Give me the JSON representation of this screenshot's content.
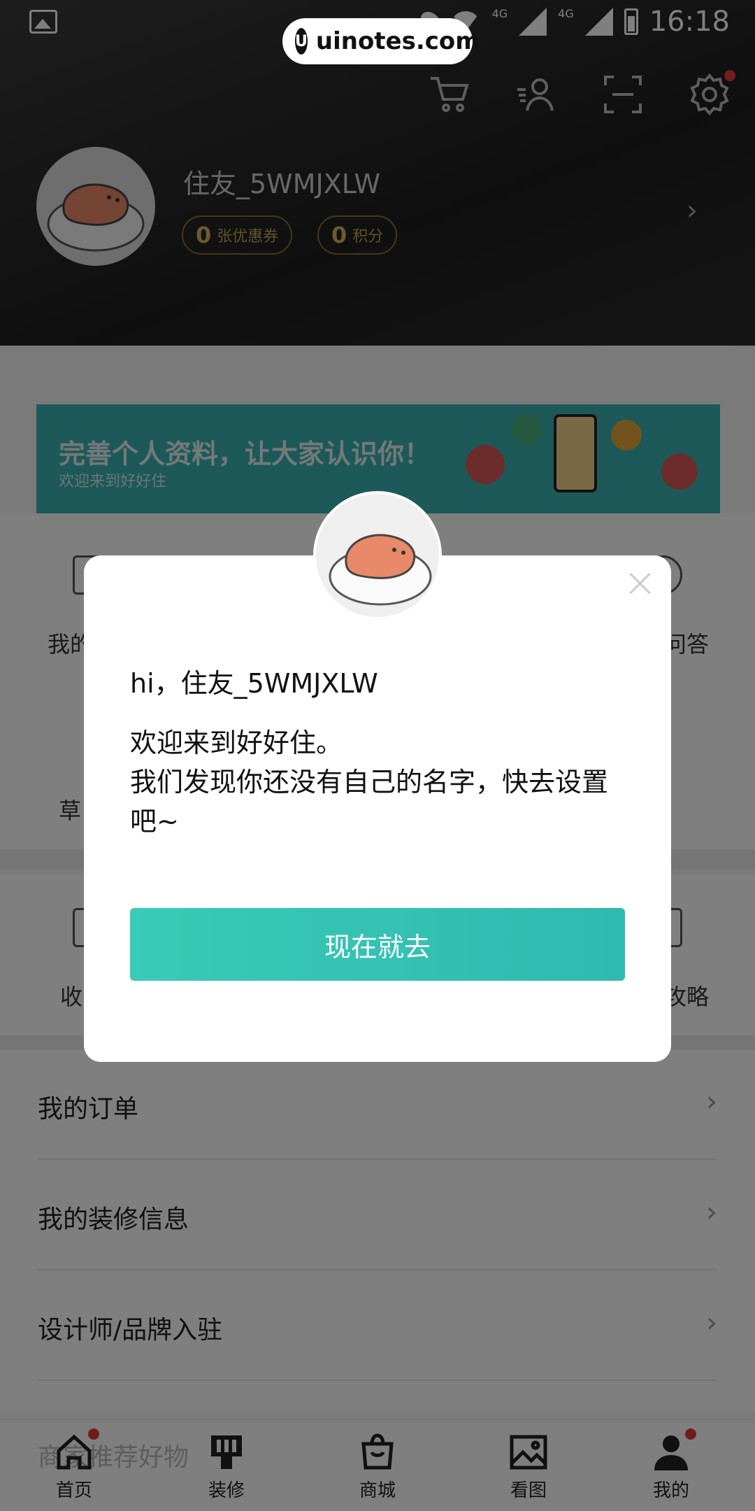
{
  "status_bar": {
    "network1": "4G",
    "network2": "4G",
    "time": "16:18"
  },
  "watermark": {
    "logo": "U",
    "text": "uinotes.com"
  },
  "header": {
    "icons": [
      "cart-icon",
      "user-list-icon",
      "scan-icon",
      "settings-icon"
    ],
    "username": "住友_5WMJXLW",
    "coupons": {
      "value": "0",
      "label": "张优惠券"
    },
    "points": {
      "value": "0",
      "label": "积分"
    },
    "chevron": "›"
  },
  "banner": {
    "title": "完善个人资料，让大家认识你！",
    "subtitle": "欢迎来到好好住"
  },
  "grid_partial": {
    "row1_left": "我的",
    "row1_right": "问答",
    "row2_left": "草",
    "row3_left": "收",
    "row3_right": "攻略"
  },
  "list": [
    {
      "label": "我的订单"
    },
    {
      "label": "我的装修信息"
    },
    {
      "label": "设计师/品牌入驻"
    }
  ],
  "faded_row": "商家推荐好物",
  "row_chevron": "›",
  "bottom_nav": [
    {
      "label": "首页",
      "icon": "home-icon"
    },
    {
      "label": "装修",
      "icon": "decorate-icon"
    },
    {
      "label": "商城",
      "icon": "shop-bag-icon"
    },
    {
      "label": "看图",
      "icon": "image-icon"
    },
    {
      "label": "我的",
      "icon": "profile-icon"
    }
  ],
  "modal": {
    "greeting": "hi，住友_5WMJXLW",
    "line1": "欢迎来到好好住。",
    "line2": "我们发现你还没有自己的名字，快去设置吧~",
    "button": "现在就去"
  },
  "colors": {
    "accent": "#2fbab0",
    "banner": "#3bb3b2",
    "badge_red": "#e23b3b",
    "gold": "#d6b565"
  }
}
